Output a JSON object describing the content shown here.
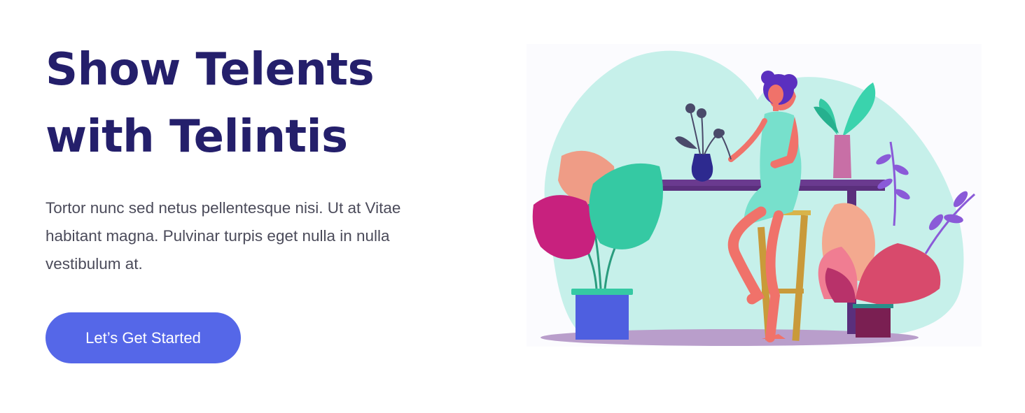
{
  "hero": {
    "title_line1": "Show Telents",
    "title_line2": "with Telintis",
    "description": "Tortor nunc sed netus pellentesque nisi. Ut at Vitae habitant magna. Pulvinar turpis eget nulla in nulla vestibulum at.",
    "cta_label": "Let’s Get Started"
  },
  "colors": {
    "title": "#241f6b",
    "text": "#4b4b5a",
    "button": "#5567e8",
    "illustration_bg": "#c6f0ea"
  }
}
